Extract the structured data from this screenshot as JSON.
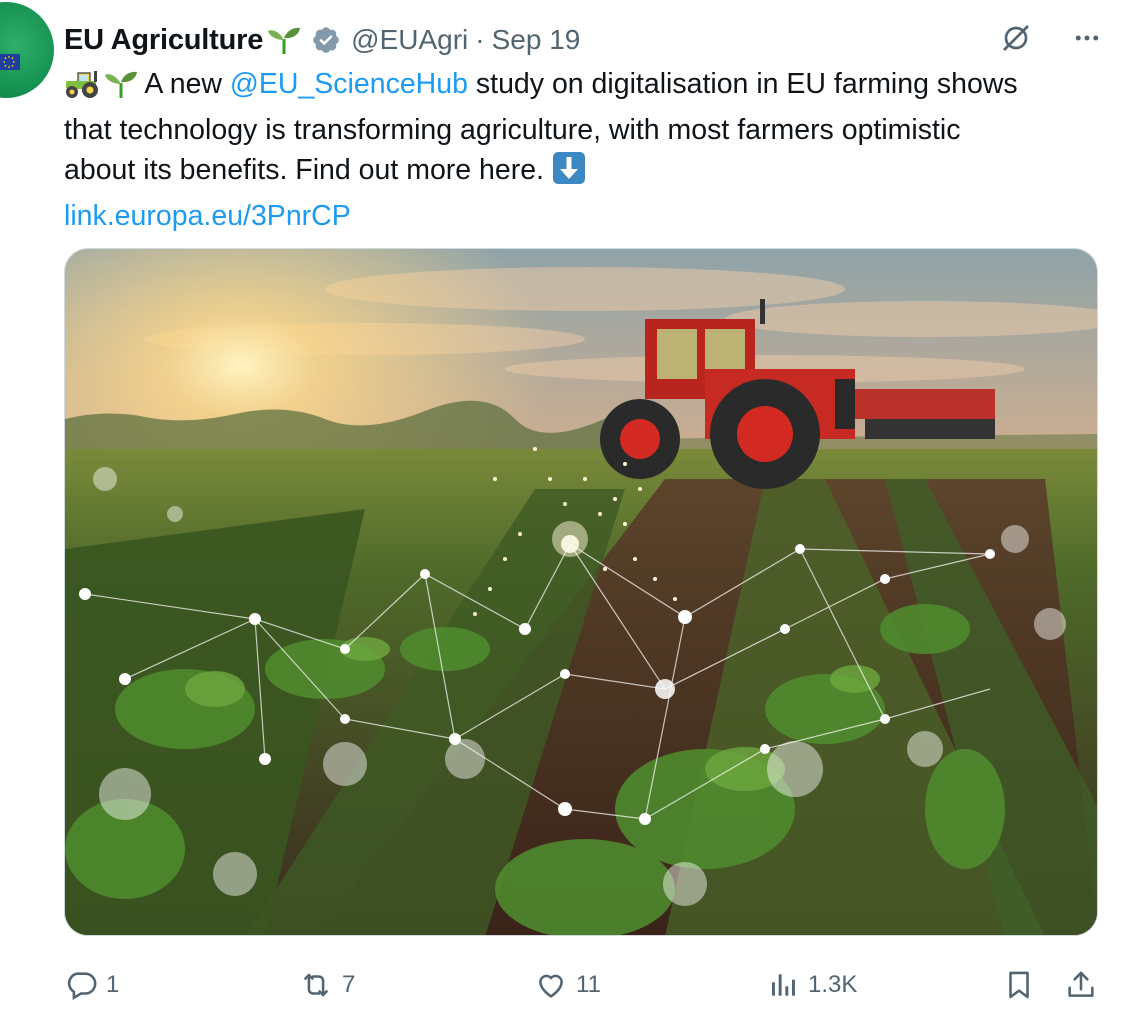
{
  "tweet": {
    "author_name": "EU Agriculture",
    "handle": "@EUAgri",
    "separator": "·",
    "date": "Sep 19",
    "lines": {
      "line1_after_mention": " study on digitalisation in EU farming shows",
      "line1_before_mention": "A new ",
      "mention": "@EU_ScienceHub",
      "line2": "that technology is transforming agriculture, with most farmers optimistic",
      "line3": "about its benefits. Find out more here. ",
      "link": "link.europa.eu/3PnrCP"
    },
    "emojis": [
      "tractor-emoji",
      "seedling-emoji",
      "down-arrow-emoji"
    ],
    "media": {
      "description_icon": "image"
    }
  },
  "actions": {
    "reply_count": "1",
    "retweet_count": "7",
    "like_count": "11",
    "views_count": "1.3K"
  },
  "colors": {
    "accent": "#1d9bf0",
    "muted": "#536471",
    "text": "#0f1419",
    "verified": "#829aab",
    "avatar_green": "#149050"
  },
  "icons": [
    "verified-badge-icon",
    "grok-icon",
    "more-icon",
    "reply-icon",
    "retweet-icon",
    "like-icon",
    "views-icon",
    "bookmark-icon",
    "share-icon"
  ]
}
